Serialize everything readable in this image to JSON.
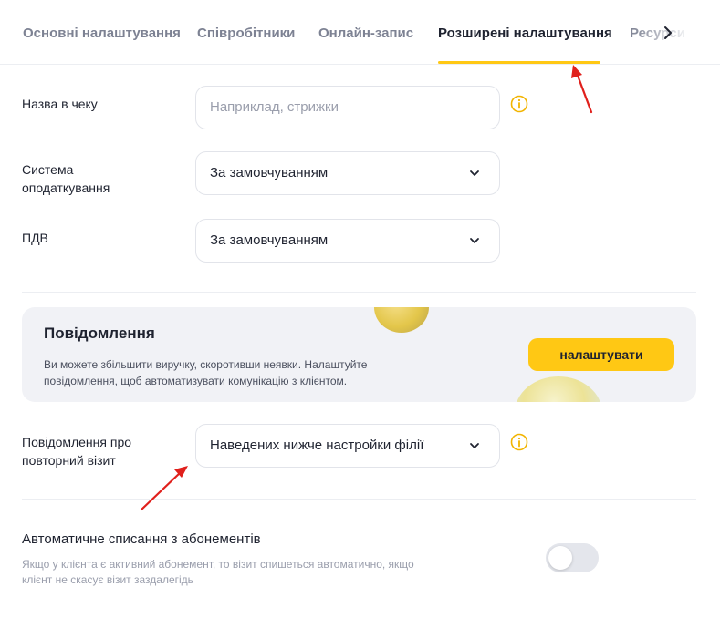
{
  "tabs": [
    {
      "label": "Основні налаштування",
      "active": false
    },
    {
      "label": "Співробітники",
      "active": false
    },
    {
      "label": "Онлайн-запис",
      "active": false
    },
    {
      "label": "Розширені налаштування",
      "active": true
    },
    {
      "label": "Ресурси",
      "active": false
    }
  ],
  "receipt_name": {
    "label": "Назва в чеку",
    "placeholder": "Наприклад, стрижки",
    "value": ""
  },
  "tax_system": {
    "label_line1": "Система",
    "label_line2": "оподаткування",
    "value": "За замовчуванням"
  },
  "vat": {
    "label": "ПДВ",
    "value": "За замовчуванням"
  },
  "notifications_banner": {
    "title": "Повідомлення",
    "text": "Ви можете збільшити виручку, скоротивши неявки. Налаштуйте повідомлення, щоб автоматизувати комунікацію з клієнтом.",
    "button_label": "налаштувати"
  },
  "repeat_visit": {
    "label_line1": "Повідомлення про",
    "label_line2": "повторний візит",
    "value": "Наведених нижче настройки філії"
  },
  "auto_writeoff": {
    "title": "Автоматичне списання з абонементів",
    "description": "Якщо у клієнта є активний абонемент, то візит спишеться автоматично, якщо клієнт не скасує візит заздалегідь",
    "enabled": false
  },
  "colors": {
    "accent": "#ffc814",
    "annotation_arrow": "#e0201c",
    "text_primary": "#1f2330",
    "text_muted": "#7d8293"
  },
  "icons": [
    "chevron-right-icon",
    "info-icon",
    "chevron-down-icon",
    "toggle-switch"
  ]
}
